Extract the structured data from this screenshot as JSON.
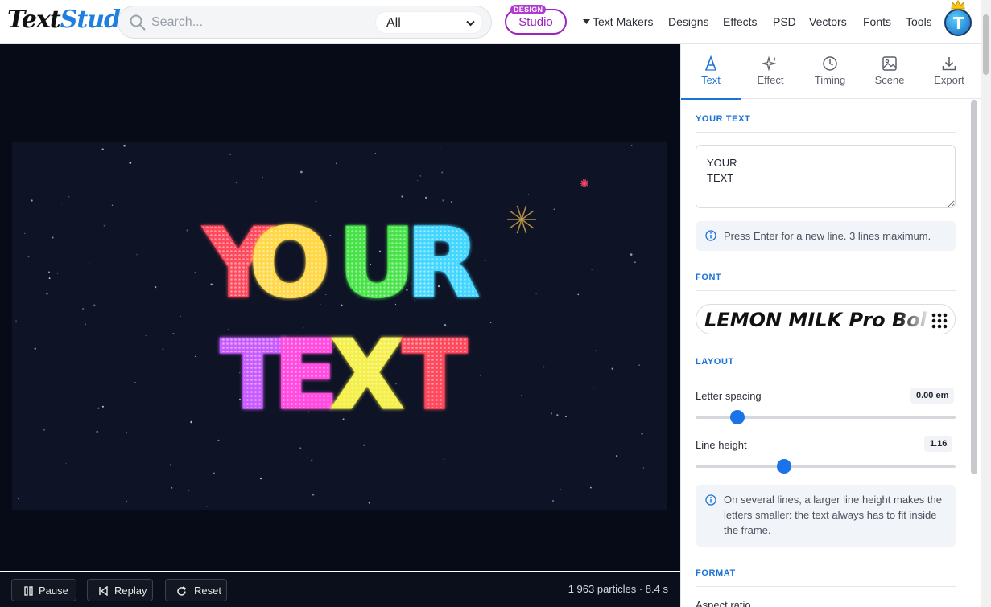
{
  "header": {
    "logo_part1": "Text",
    "logo_part2": "Studio",
    "search_placeholder": "Search...",
    "search_filter": "All",
    "studio_tag": "DESIGN",
    "studio_label": "Studio",
    "nav": [
      "Text Makers",
      "Designs",
      "Effects",
      "PSD",
      "Vectors",
      "Fonts",
      "Tools"
    ],
    "avatar_letter": "T"
  },
  "canvas": {
    "line1_letters": [
      "Y",
      "O",
      "U",
      "R"
    ],
    "line2_letters": [
      "T",
      "E",
      "X",
      "T"
    ],
    "line1_colors": [
      "#ff4a5c",
      "#ffd84a",
      "#46e34a",
      "#44d6ff"
    ],
    "line2_colors": [
      "#c85cff",
      "#ff4ee0",
      "#f4f04a",
      "#ff4a5c"
    ]
  },
  "playback": {
    "pause_label": "Pause",
    "replay_label": "Replay",
    "reset_label": "Reset",
    "status": "1 963 particles · 8.4 s"
  },
  "panel": {
    "tabs": [
      "Text",
      "Effect",
      "Timing",
      "Scene",
      "Export"
    ],
    "active_tab": "Text",
    "your_text": {
      "heading": "YOUR TEXT",
      "value": "YOUR\nTEXT",
      "hint": "Press Enter for a new line. 3 lines maximum."
    },
    "font": {
      "heading": "FONT",
      "name": "LEMON MILK Pro Bold"
    },
    "layout": {
      "heading": "LAYOUT",
      "letter_spacing_label": "Letter spacing",
      "letter_spacing_value": "0.00 em",
      "letter_spacing_fraction": 0.16,
      "line_height_label": "Line height",
      "line_height_value": "1.16",
      "line_height_fraction": 0.34,
      "hint": "On several lines, a larger line height makes the letters smaller: the text always has to fit inside the frame."
    },
    "format": {
      "heading": "FORMAT",
      "aspect_label": "Aspect ratio"
    }
  },
  "colors": {
    "accent": "#1a73d6",
    "studio": "#a020c0",
    "stage_bg": "#070b18"
  }
}
